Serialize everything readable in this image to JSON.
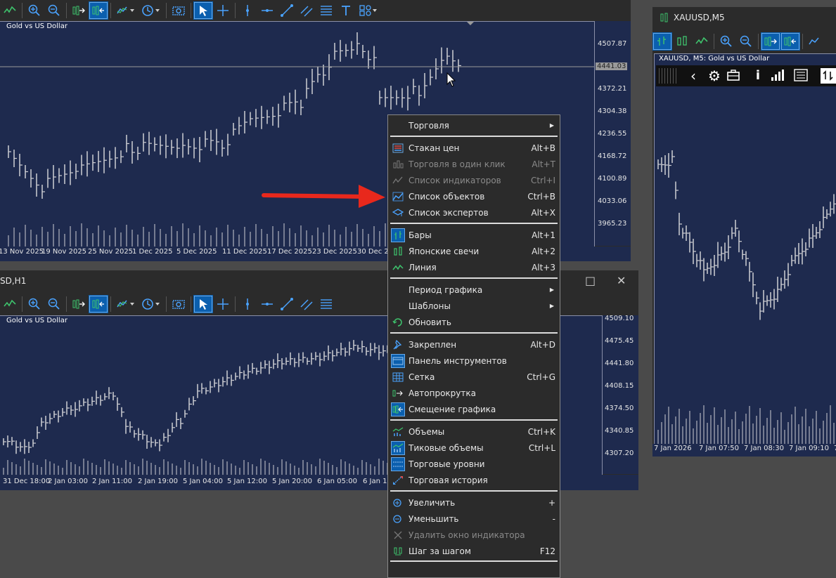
{
  "top_window": {
    "chart_title": "Gold vs US Dollar",
    "price_labels": [
      "4507.87",
      "4441.03",
      "4372.21",
      "4304.38",
      "4236.55",
      "4168.72",
      "4100.89",
      "4033.06",
      "3965.23"
    ],
    "time_labels": [
      "13 Nov 2025",
      "19 Nov 2025",
      "25 Nov 2025",
      "1 Dec 2025",
      "5 Dec 2025",
      "11 Dec 2025",
      "17 Dec 2025",
      "23 Dec 2025",
      "30 Dec 20"
    ]
  },
  "bottom_window": {
    "title": "SD,H1",
    "chart_title": "Gold vs US Dollar",
    "price_labels": [
      "4509.10",
      "4475.45",
      "4441.80",
      "4408.15",
      "4374.50",
      "4340.85",
      "4307.20"
    ],
    "time_labels": [
      "31 Dec 18:00",
      "2 Jan 03:00",
      "2 Jan 11:00",
      "2 Jan 19:00",
      "5 Jan 04:00",
      "5 Jan 12:00",
      "5 Jan 20:00",
      "6 Jan 05:00",
      "6 Jan 13"
    ]
  },
  "right_window": {
    "title": "XAUUSD,M5",
    "chart_title": "XAUUSD, M5:  Gold vs US Dollar",
    "time_labels": [
      "7 Jan 2026",
      "7 Jan 07:50",
      "7 Jan 08:30",
      "7 Jan 09:10",
      "7"
    ]
  },
  "context_menu": {
    "items": [
      {
        "label": "Торговля",
        "shortcut": "",
        "submenu": true,
        "disabled": false,
        "icon": ""
      },
      {
        "label": "Стакан цен",
        "shortcut": "Alt+B",
        "disabled": false,
        "icon": "depth-of-market-icon"
      },
      {
        "label": "Торговля в один клик",
        "shortcut": "Alt+T",
        "disabled": true,
        "icon": "one-click-trading-icon"
      },
      {
        "label": "Список индикаторов",
        "shortcut": "Ctrl+I",
        "disabled": true,
        "icon": "indicators-list-icon"
      },
      {
        "label": "Список объектов",
        "shortcut": "Ctrl+B",
        "disabled": false,
        "icon": "objects-list-icon"
      },
      {
        "label": "Список экспертов",
        "shortcut": "Alt+X",
        "disabled": false,
        "icon": "experts-list-icon"
      },
      {
        "label": "Бары",
        "shortcut": "Alt+1",
        "disabled": false,
        "icon": "bars-icon"
      },
      {
        "label": "Японские свечи",
        "shortcut": "Alt+2",
        "disabled": false,
        "icon": "candlesticks-icon"
      },
      {
        "label": "Линия",
        "shortcut": "Alt+3",
        "disabled": false,
        "icon": "line-chart-icon"
      },
      {
        "label": "Период графика",
        "shortcut": "",
        "submenu": true,
        "disabled": false,
        "icon": ""
      },
      {
        "label": "Шаблоны",
        "shortcut": "",
        "submenu": true,
        "disabled": false,
        "icon": ""
      },
      {
        "label": "Обновить",
        "shortcut": "",
        "disabled": false,
        "icon": "refresh-icon"
      },
      {
        "label": "Закреплен",
        "shortcut": "Alt+D",
        "disabled": false,
        "icon": "pin-icon"
      },
      {
        "label": "Панель инструментов",
        "shortcut": "",
        "disabled": false,
        "icon": "toolbar-panel-icon"
      },
      {
        "label": "Сетка",
        "shortcut": "Ctrl+G",
        "disabled": false,
        "icon": "grid-icon"
      },
      {
        "label": "Автопрокрутка",
        "shortcut": "",
        "disabled": false,
        "icon": "autoscroll-icon"
      },
      {
        "label": "Смещение графика",
        "shortcut": "",
        "disabled": false,
        "icon": "chart-shift-icon"
      },
      {
        "label": "Объемы",
        "shortcut": "Ctrl+K",
        "disabled": false,
        "icon": "volumes-icon"
      },
      {
        "label": "Тиковые объемы",
        "shortcut": "Ctrl+L",
        "disabled": false,
        "icon": "tick-volumes-icon"
      },
      {
        "label": "Торговые уровни",
        "shortcut": "",
        "disabled": false,
        "icon": "trade-levels-icon"
      },
      {
        "label": "Торговая история",
        "shortcut": "",
        "disabled": false,
        "icon": "trade-history-icon"
      },
      {
        "label": "Увеличить",
        "shortcut": "+",
        "disabled": false,
        "icon": "zoom-in-icon"
      },
      {
        "label": "Уменьшить",
        "shortcut": "-",
        "disabled": false,
        "icon": "zoom-out-icon"
      },
      {
        "label": "Удалить окно индикатора",
        "shortcut": "",
        "disabled": true,
        "icon": "delete-window-icon"
      },
      {
        "label": "Шаг за шагом",
        "shortcut": "F12",
        "disabled": false,
        "icon": "step-by-step-icon"
      }
    ]
  }
}
